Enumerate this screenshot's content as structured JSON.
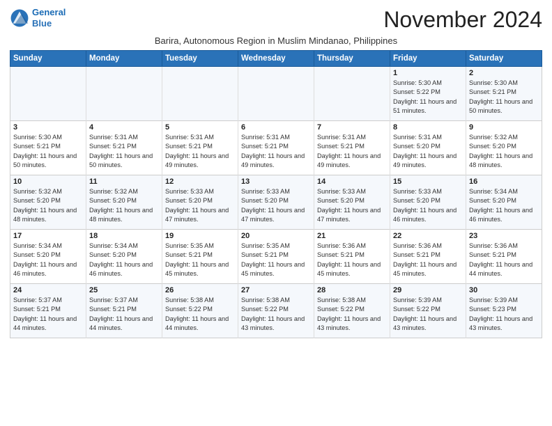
{
  "header": {
    "logo_line1": "General",
    "logo_line2": "Blue",
    "month_title": "November 2024",
    "subtitle": "Barira, Autonomous Region in Muslim Mindanao, Philippines"
  },
  "days_of_week": [
    "Sunday",
    "Monday",
    "Tuesday",
    "Wednesday",
    "Thursday",
    "Friday",
    "Saturday"
  ],
  "weeks": [
    [
      {
        "day": "",
        "info": ""
      },
      {
        "day": "",
        "info": ""
      },
      {
        "day": "",
        "info": ""
      },
      {
        "day": "",
        "info": ""
      },
      {
        "day": "",
        "info": ""
      },
      {
        "day": "1",
        "info": "Sunrise: 5:30 AM\nSunset: 5:22 PM\nDaylight: 11 hours and 51 minutes."
      },
      {
        "day": "2",
        "info": "Sunrise: 5:30 AM\nSunset: 5:21 PM\nDaylight: 11 hours and 50 minutes."
      }
    ],
    [
      {
        "day": "3",
        "info": "Sunrise: 5:30 AM\nSunset: 5:21 PM\nDaylight: 11 hours and 50 minutes."
      },
      {
        "day": "4",
        "info": "Sunrise: 5:31 AM\nSunset: 5:21 PM\nDaylight: 11 hours and 50 minutes."
      },
      {
        "day": "5",
        "info": "Sunrise: 5:31 AM\nSunset: 5:21 PM\nDaylight: 11 hours and 49 minutes."
      },
      {
        "day": "6",
        "info": "Sunrise: 5:31 AM\nSunset: 5:21 PM\nDaylight: 11 hours and 49 minutes."
      },
      {
        "day": "7",
        "info": "Sunrise: 5:31 AM\nSunset: 5:21 PM\nDaylight: 11 hours and 49 minutes."
      },
      {
        "day": "8",
        "info": "Sunrise: 5:31 AM\nSunset: 5:20 PM\nDaylight: 11 hours and 49 minutes."
      },
      {
        "day": "9",
        "info": "Sunrise: 5:32 AM\nSunset: 5:20 PM\nDaylight: 11 hours and 48 minutes."
      }
    ],
    [
      {
        "day": "10",
        "info": "Sunrise: 5:32 AM\nSunset: 5:20 PM\nDaylight: 11 hours and 48 minutes."
      },
      {
        "day": "11",
        "info": "Sunrise: 5:32 AM\nSunset: 5:20 PM\nDaylight: 11 hours and 48 minutes."
      },
      {
        "day": "12",
        "info": "Sunrise: 5:33 AM\nSunset: 5:20 PM\nDaylight: 11 hours and 47 minutes."
      },
      {
        "day": "13",
        "info": "Sunrise: 5:33 AM\nSunset: 5:20 PM\nDaylight: 11 hours and 47 minutes."
      },
      {
        "day": "14",
        "info": "Sunrise: 5:33 AM\nSunset: 5:20 PM\nDaylight: 11 hours and 47 minutes."
      },
      {
        "day": "15",
        "info": "Sunrise: 5:33 AM\nSunset: 5:20 PM\nDaylight: 11 hours and 46 minutes."
      },
      {
        "day": "16",
        "info": "Sunrise: 5:34 AM\nSunset: 5:20 PM\nDaylight: 11 hours and 46 minutes."
      }
    ],
    [
      {
        "day": "17",
        "info": "Sunrise: 5:34 AM\nSunset: 5:20 PM\nDaylight: 11 hours and 46 minutes."
      },
      {
        "day": "18",
        "info": "Sunrise: 5:34 AM\nSunset: 5:20 PM\nDaylight: 11 hours and 46 minutes."
      },
      {
        "day": "19",
        "info": "Sunrise: 5:35 AM\nSunset: 5:21 PM\nDaylight: 11 hours and 45 minutes."
      },
      {
        "day": "20",
        "info": "Sunrise: 5:35 AM\nSunset: 5:21 PM\nDaylight: 11 hours and 45 minutes."
      },
      {
        "day": "21",
        "info": "Sunrise: 5:36 AM\nSunset: 5:21 PM\nDaylight: 11 hours and 45 minutes."
      },
      {
        "day": "22",
        "info": "Sunrise: 5:36 AM\nSunset: 5:21 PM\nDaylight: 11 hours and 45 minutes."
      },
      {
        "day": "23",
        "info": "Sunrise: 5:36 AM\nSunset: 5:21 PM\nDaylight: 11 hours and 44 minutes."
      }
    ],
    [
      {
        "day": "24",
        "info": "Sunrise: 5:37 AM\nSunset: 5:21 PM\nDaylight: 11 hours and 44 minutes."
      },
      {
        "day": "25",
        "info": "Sunrise: 5:37 AM\nSunset: 5:21 PM\nDaylight: 11 hours and 44 minutes."
      },
      {
        "day": "26",
        "info": "Sunrise: 5:38 AM\nSunset: 5:22 PM\nDaylight: 11 hours and 44 minutes."
      },
      {
        "day": "27",
        "info": "Sunrise: 5:38 AM\nSunset: 5:22 PM\nDaylight: 11 hours and 43 minutes."
      },
      {
        "day": "28",
        "info": "Sunrise: 5:38 AM\nSunset: 5:22 PM\nDaylight: 11 hours and 43 minutes."
      },
      {
        "day": "29",
        "info": "Sunrise: 5:39 AM\nSunset: 5:22 PM\nDaylight: 11 hours and 43 minutes."
      },
      {
        "day": "30",
        "info": "Sunrise: 5:39 AM\nSunset: 5:23 PM\nDaylight: 11 hours and 43 minutes."
      }
    ]
  ]
}
